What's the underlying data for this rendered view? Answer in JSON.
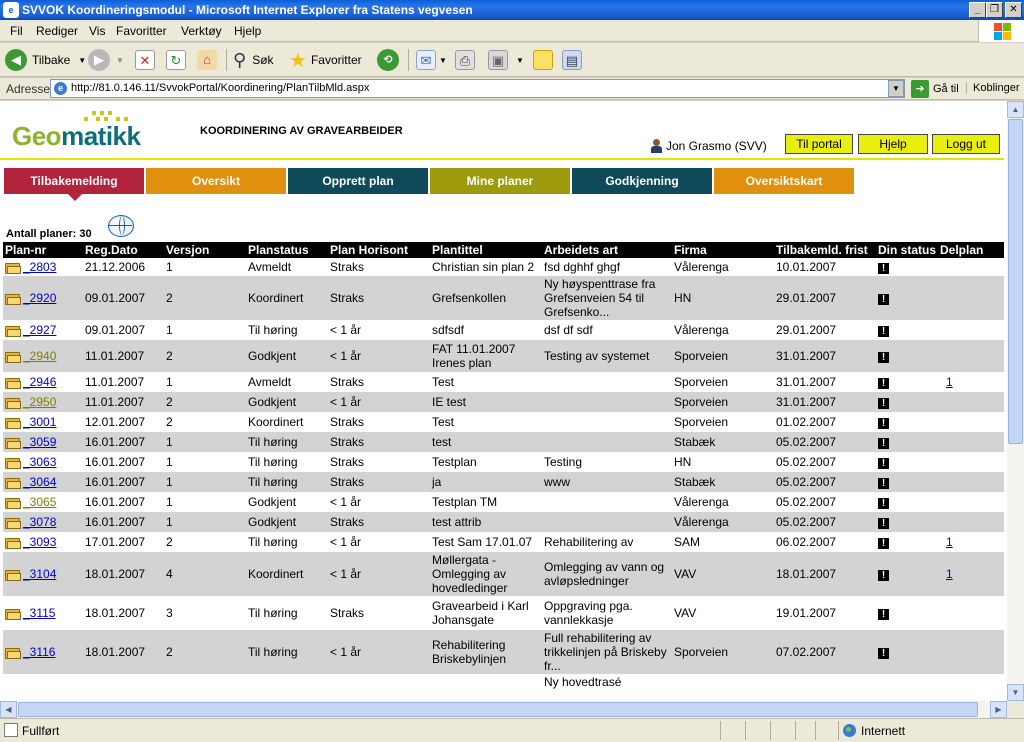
{
  "window": {
    "title": "SVVOK Koordineringsmodul - Microsoft Internet Explorer fra Statens vegvesen",
    "icon_text": "e"
  },
  "menu": [
    "Fil",
    "Rediger",
    "Vis",
    "Favoritter",
    "Verktøy",
    "Hjelp"
  ],
  "toolbar": {
    "back_label": "Tilbake",
    "search_label": "Søk",
    "favorites_label": "Favoritter"
  },
  "address": {
    "label": "Adresse",
    "url": "http://81.0.146.11/SvvokPortal/Koordinering/PlanTilbMld.aspx",
    "go_label": "Gå til",
    "links_label": "Koblinger"
  },
  "page": {
    "logo_part1": "Geo",
    "logo_part2": "matikk",
    "heading": "KOORDINERING AV GRAVEARBEIDER",
    "user_name": "Jon Grasmo (SVV)",
    "buttons": [
      "Til portal",
      "Hjelp",
      "Logg ut"
    ],
    "count_label": "Antall planer: 30"
  },
  "tabs": [
    {
      "label": "Tilbakemelding",
      "color": "#b2243c"
    },
    {
      "label": "Oversikt",
      "color": "#e0900e"
    },
    {
      "label": "Opprett plan",
      "color": "#0f4a5a"
    },
    {
      "label": "Mine planer",
      "color": "#9e9a0d"
    },
    {
      "label": "Godkjenning",
      "color": "#0f4a5a"
    },
    {
      "label": "Oversiktskart",
      "color": "#e0900e"
    }
  ],
  "table": {
    "headers": [
      "Plan-nr",
      "Reg.Dato",
      "Versjon",
      "Planstatus",
      "Plan Horisont",
      "Plantittel",
      "Arbeidets art",
      "Firma",
      "Tilbakemld. frist",
      "Din status",
      "Delplan"
    ],
    "rows": [
      {
        "nr": "2803",
        "link": "blue",
        "dato": "21.12.2006",
        "versjon": "1",
        "status": "Avmeldt",
        "horisont": "Straks",
        "tittel": "Christian sin plan 2",
        "art": "fsd dghhf ghgf",
        "firma": "Vålerenga",
        "frist": "10.01.2007",
        "delplan": ""
      },
      {
        "nr": "2920",
        "link": "blue",
        "dato": "09.01.2007",
        "versjon": "2",
        "status": "Koordinert",
        "horisont": "Straks",
        "tittel": "Grefsenkollen",
        "art": "Ny høyspenttrase fra Grefsenveien 54 til Grefsenko...",
        "firma": "HN",
        "frist": "29.01.2007",
        "delplan": ""
      },
      {
        "nr": "2927",
        "link": "blue",
        "dato": "09.01.2007",
        "versjon": "1",
        "status": "Til høring",
        "horisont": "< 1 år",
        "tittel": "sdfsdf",
        "art": "dsf df sdf",
        "firma": "Vålerenga",
        "frist": "29.01.2007",
        "delplan": ""
      },
      {
        "nr": "2940",
        "link": "olive",
        "dato": "11.01.2007",
        "versjon": "2",
        "status": "Godkjent",
        "horisont": "< 1 år",
        "tittel": "FAT 11.01.2007 Irenes plan",
        "art": "Testing av systemet",
        "firma": "Sporveien",
        "frist": "31.01.2007",
        "delplan": ""
      },
      {
        "nr": "2946",
        "link": "blue",
        "dato": "11.01.2007",
        "versjon": "1",
        "status": "Avmeldt",
        "horisont": "Straks",
        "tittel": "Test",
        "art": "",
        "firma": "Sporveien",
        "frist": "31.01.2007",
        "delplan": "1"
      },
      {
        "nr": "2950",
        "link": "olive",
        "dato": "11.01.2007",
        "versjon": "2",
        "status": "Godkjent",
        "horisont": "< 1 år",
        "tittel": "IE test",
        "art": "",
        "firma": "Sporveien",
        "frist": "31.01.2007",
        "delplan": ""
      },
      {
        "nr": "3001",
        "link": "blue",
        "dato": "12.01.2007",
        "versjon": "2",
        "status": "Koordinert",
        "horisont": "Straks",
        "tittel": "Test",
        "art": "",
        "firma": "Sporveien",
        "frist": "01.02.2007",
        "delplan": ""
      },
      {
        "nr": "3059",
        "link": "blue",
        "dato": "16.01.2007",
        "versjon": "1",
        "status": "Til høring",
        "horisont": "Straks",
        "tittel": "test",
        "art": "",
        "firma": "Stabæk",
        "frist": "05.02.2007",
        "delplan": ""
      },
      {
        "nr": "3063",
        "link": "blue",
        "dato": "16.01.2007",
        "versjon": "1",
        "status": "Til høring",
        "horisont": "Straks",
        "tittel": "Testplan",
        "art": "Testing",
        "firma": "HN",
        "frist": "05.02.2007",
        "delplan": ""
      },
      {
        "nr": "3064",
        "link": "blue",
        "dato": "16.01.2007",
        "versjon": "1",
        "status": "Til høring",
        "horisont": "Straks",
        "tittel": "ja",
        "art": "www",
        "firma": "Stabæk",
        "frist": "05.02.2007",
        "delplan": ""
      },
      {
        "nr": "3065",
        "link": "olive",
        "dato": "16.01.2007",
        "versjon": "1",
        "status": "Godkjent",
        "horisont": "< 1 år",
        "tittel": "Testplan TM",
        "art": "",
        "firma": "Vålerenga",
        "frist": "05.02.2007",
        "delplan": ""
      },
      {
        "nr": "3078",
        "link": "blue",
        "dato": "16.01.2007",
        "versjon": "1",
        "status": "Godkjent",
        "horisont": "Straks",
        "tittel": "test attrib",
        "art": "",
        "firma": "Vålerenga",
        "frist": "05.02.2007",
        "delplan": ""
      },
      {
        "nr": "3093",
        "link": "blue",
        "dato": "17.01.2007",
        "versjon": "2",
        "status": "Til høring",
        "horisont": "< 1 år",
        "tittel": "Test Sam 17.01.07",
        "art": "Rehabilitering av",
        "firma": "SAM",
        "frist": "06.02.2007",
        "delplan": "1"
      },
      {
        "nr": "3104",
        "link": "blue",
        "dato": "18.01.2007",
        "versjon": "4",
        "status": "Koordinert",
        "horisont": "< 1 år",
        "tittel": "Møllergata - Omlegging av hovedledinger",
        "art": "Omlegging av vann og avløpsledninger",
        "firma": "VAV",
        "frist": "18.01.2007",
        "delplan": "1"
      },
      {
        "nr": "3115",
        "link": "blue",
        "dato": "18.01.2007",
        "versjon": "3",
        "status": "Til høring",
        "horisont": "Straks",
        "tittel": "Gravearbeid i Karl Johansgate",
        "art": "Oppgraving pga. vannlekkasje",
        "firma": "VAV",
        "frist": "19.01.2007",
        "delplan": ""
      },
      {
        "nr": "3116",
        "link": "blue",
        "dato": "18.01.2007",
        "versjon": "2",
        "status": "Til høring",
        "horisont": "< 1 år",
        "tittel": "Rehabilitering Briskebylinjen",
        "art": "Full rehabilitering av trikkelinjen på Briskeby fr...",
        "firma": "Sporveien",
        "frist": "07.02.2007",
        "delplan": ""
      },
      {
        "nr": "",
        "link": "blue",
        "dato": "",
        "versjon": "",
        "status": "",
        "horisont": "",
        "tittel": "",
        "art": "Ny hovedtrasé",
        "firma": "",
        "frist": "",
        "delplan": "",
        "partial": true
      }
    ]
  },
  "status": {
    "text": "Fullført",
    "zone": "Internett"
  }
}
